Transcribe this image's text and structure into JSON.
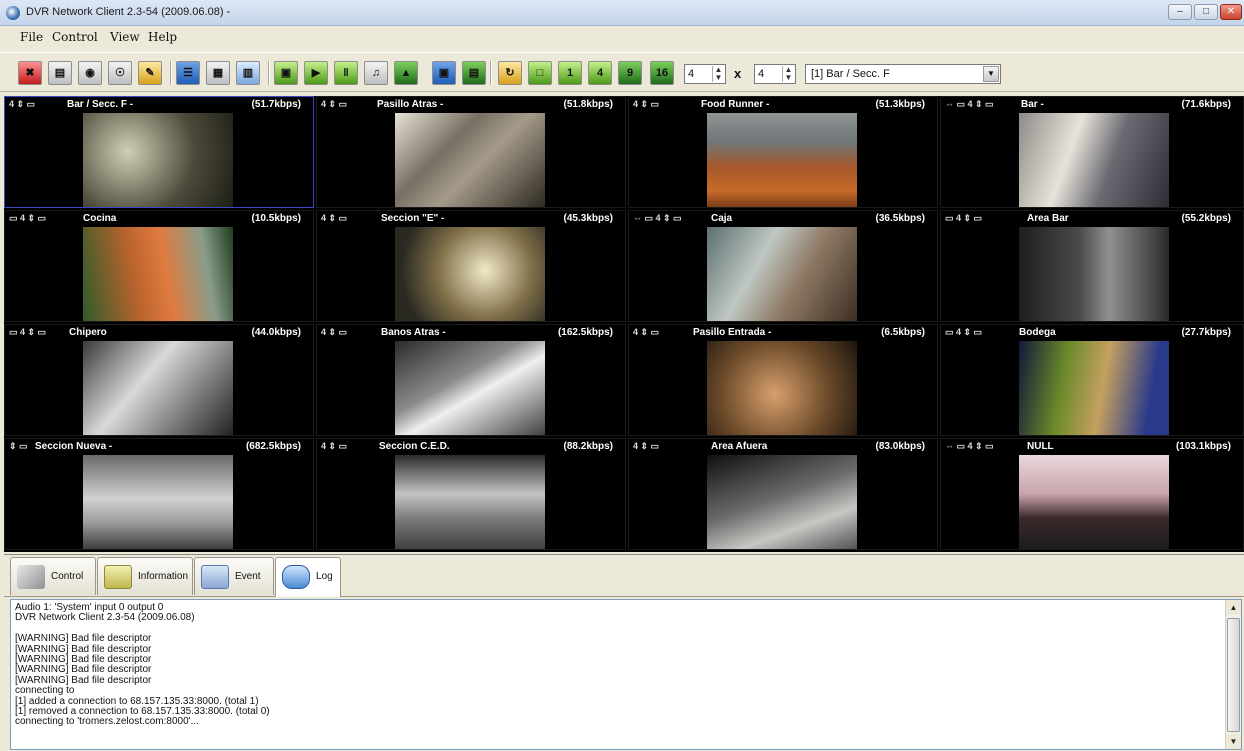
{
  "window": {
    "title": "DVR Network Client 2.3-54 (2009.06.08) -",
    "min_glyph": "–",
    "max_glyph": "□",
    "close_glyph": "✕"
  },
  "menu": [
    "File",
    "Control",
    "View",
    "Help"
  ],
  "toolbar": {
    "buttons": [
      {
        "name": "connect-icon",
        "glyph": "✖",
        "color": "red"
      },
      {
        "name": "monitor-icon",
        "glyph": "▤",
        "color": "gray"
      },
      {
        "name": "camera-icon",
        "glyph": "◉",
        "color": "gray"
      },
      {
        "name": "zoom-icon",
        "glyph": "☉",
        "color": "gray"
      },
      {
        "name": "tools-icon",
        "glyph": "✎",
        "color": "yellow"
      },
      {
        "name": "layout-1-icon",
        "glyph": "☰",
        "color": "blue"
      },
      {
        "name": "layout-2-icon",
        "glyph": "▦",
        "color": "gray"
      },
      {
        "name": "layout-3-icon",
        "glyph": "▥",
        "color": "lblue"
      },
      {
        "name": "record-icon",
        "glyph": "▣",
        "color": "green"
      },
      {
        "name": "play-icon",
        "glyph": "▶",
        "color": "green"
      },
      {
        "name": "pause-icon",
        "glyph": "‖",
        "color": "green"
      },
      {
        "name": "audio-icon",
        "glyph": "♫",
        "color": "gray"
      },
      {
        "name": "ptz-icon",
        "glyph": "▲",
        "color": "dgreen"
      },
      {
        "name": "snapshot-icon",
        "glyph": "▣",
        "color": "blue"
      },
      {
        "name": "print-icon",
        "glyph": "▤",
        "color": "dgreen"
      },
      {
        "name": "refresh-icon",
        "glyph": "↻",
        "color": "yellow"
      },
      {
        "name": "view-1-icon",
        "glyph": "□",
        "color": "green"
      },
      {
        "name": "view-4-icon",
        "glyph": "1",
        "color": "green"
      },
      {
        "name": "view-9-icon",
        "glyph": "4",
        "color": "green"
      },
      {
        "name": "view-16-icon",
        "glyph": "9",
        "color": "dgreen"
      },
      {
        "name": "view-full-icon",
        "glyph": "16",
        "color": "dgreen"
      }
    ],
    "rows_value": "4",
    "cols_value": "4",
    "times": "x",
    "camera_select": "[1] Bar / Secc. F"
  },
  "cameras": [
    {
      "name": "Bar / Secc. F -",
      "rate": "(51.7kbps)",
      "ctrl": "4  ⇕ ▭"
    },
    {
      "name": "Pasillo Atras -",
      "rate": "(51.8kbps)",
      "ctrl": "4  ⇕ ▭"
    },
    {
      "name": "Food Runner -",
      "rate": "(51.3kbps)",
      "ctrl": "4  ⇕ ▭"
    },
    {
      "name": "Bar -",
      "rate": "(71.6kbps)",
      "ctrl": "⇔ ▭ 4  ⇕ ▭"
    },
    {
      "name": "Cocina",
      "rate": "(10.5kbps)",
      "ctrl": "▭ 4  ⇕ ▭"
    },
    {
      "name": "Seccion \"E\" -",
      "rate": "(45.3kbps)",
      "ctrl": "4  ⇕ ▭"
    },
    {
      "name": "Caja",
      "rate": "(36.5kbps)",
      "ctrl": "⇔ ▭ 4  ⇕ ▭"
    },
    {
      "name": "Area Bar",
      "rate": "(55.2kbps)",
      "ctrl": "▭ 4  ⇕ ▭"
    },
    {
      "name": "Chipero",
      "rate": "(44.0kbps)",
      "ctrl": "▭ 4  ⇕ ▭"
    },
    {
      "name": "Banos Atras -",
      "rate": "(162.5kbps)",
      "ctrl": "4  ⇕ ▭"
    },
    {
      "name": "Pasillo Entrada -",
      "rate": "(6.5kbps)",
      "ctrl": "4  ⇕ ▭"
    },
    {
      "name": "Bodega",
      "rate": "(27.7kbps)",
      "ctrl": "▭ 4  ⇕ ▭"
    },
    {
      "name": "Seccion Nueva -",
      "rate": "(682.5kbps)",
      "ctrl": "⇕ ▭"
    },
    {
      "name": "Seccion C.E.D.",
      "rate": "(88.2kbps)",
      "ctrl": "4  ⇕ ▭"
    },
    {
      "name": "Area Afuera",
      "rate": "(83.0kbps)",
      "ctrl": "4  ⇕ ▭"
    },
    {
      "name": "NULL",
      "rate": "(103.1kbps)",
      "ctrl": "⇔ ▭ 4  ⇕ ▭"
    }
  ],
  "tabs": [
    {
      "label": "Control"
    },
    {
      "label": "Information"
    },
    {
      "label": "Event"
    },
    {
      "label": "Log"
    }
  ],
  "log": [
    "Audio 1: 'System' input 0 output 0",
    "DVR Network Client 2.3-54 (2009.06.08)",
    "",
    "[WARNING] Bad file descriptor",
    "[WARNING] Bad file descriptor",
    "[WARNING] Bad file descriptor",
    "[WARNING] Bad file descriptor",
    "[WARNING] Bad file descriptor",
    "connecting to",
    "[1] added a connection to 68.157.135.33:8000. (total 1)",
    "[1] removed a connection to 68.157.135.33:8000. (total 0)",
    "connecting to 'tromers.zelost.com:8000'..."
  ],
  "scroll": {
    "up": "▲",
    "down": "▼",
    "grip": "≡"
  }
}
